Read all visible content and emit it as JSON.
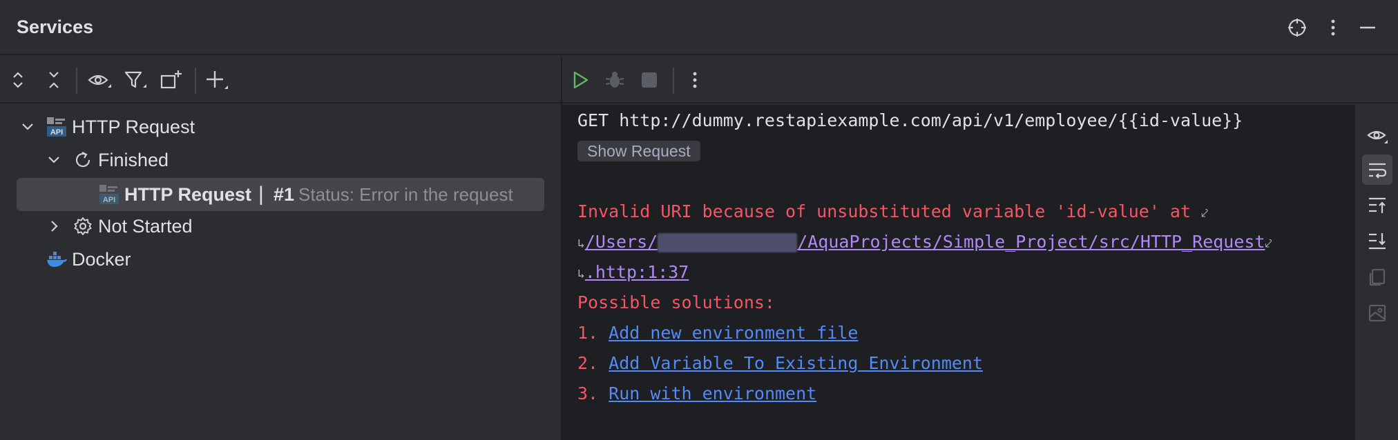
{
  "header": {
    "title": "Services",
    "icons": [
      "crosshair-icon",
      "more-vertical-icon",
      "minimize-icon"
    ]
  },
  "left_toolbar": {
    "icons": [
      "expand-all-icon",
      "collapse-all-icon",
      "view-options-icon",
      "filter-icon",
      "new-group-icon",
      "add-service-icon"
    ]
  },
  "tree": {
    "items": [
      {
        "label": "HTTP Request",
        "icon": "api-icon",
        "level": 0,
        "expanded": true
      },
      {
        "label": "Finished",
        "icon": "refresh-icon",
        "level": 1,
        "expanded": true
      },
      {
        "label": "HTTP Request",
        "run": "#1",
        "status": "Status: Error in the request",
        "icon": "api-icon",
        "level": 2,
        "selected": true
      },
      {
        "label": "Not Started",
        "icon": "gear-icon",
        "level": 1,
        "expanded": false
      },
      {
        "label": "Docker",
        "icon": "docker-icon",
        "level": 0
      }
    ]
  },
  "right_toolbar": {
    "icons": [
      "run-icon",
      "debug-icon",
      "stop-icon",
      "more-vertical-icon"
    ]
  },
  "console": {
    "request_line": "GET http://dummy.restapiexample.com/api/v1/employee/{{id-value}}",
    "show_request": "Show Request",
    "error_line": "Invalid URI because of unsubstituted variable 'id-value' at",
    "path_prefix": "/Users/",
    "path_suffix": "/AquaProjects/Simple_Project/src/HTTP_Request",
    "path_end": ".http:1:37",
    "solutions_header": "Possible solutions:",
    "solutions": [
      {
        "num": "1.",
        "label": "Add new environment file"
      },
      {
        "num": "2.",
        "label": "Add Variable To Existing Environment"
      },
      {
        "num": "3.",
        "label": "Run with environment"
      }
    ]
  },
  "right_strip": {
    "icons": [
      "view-icon",
      "soft-wrap-icon",
      "scroll-to-top-icon",
      "scroll-to-end-icon",
      "copy-icon",
      "image-icon"
    ]
  },
  "colors": {
    "error": "#f75464",
    "link": "#548af7",
    "path": "#b189f5",
    "run_green": "#5fb865"
  }
}
